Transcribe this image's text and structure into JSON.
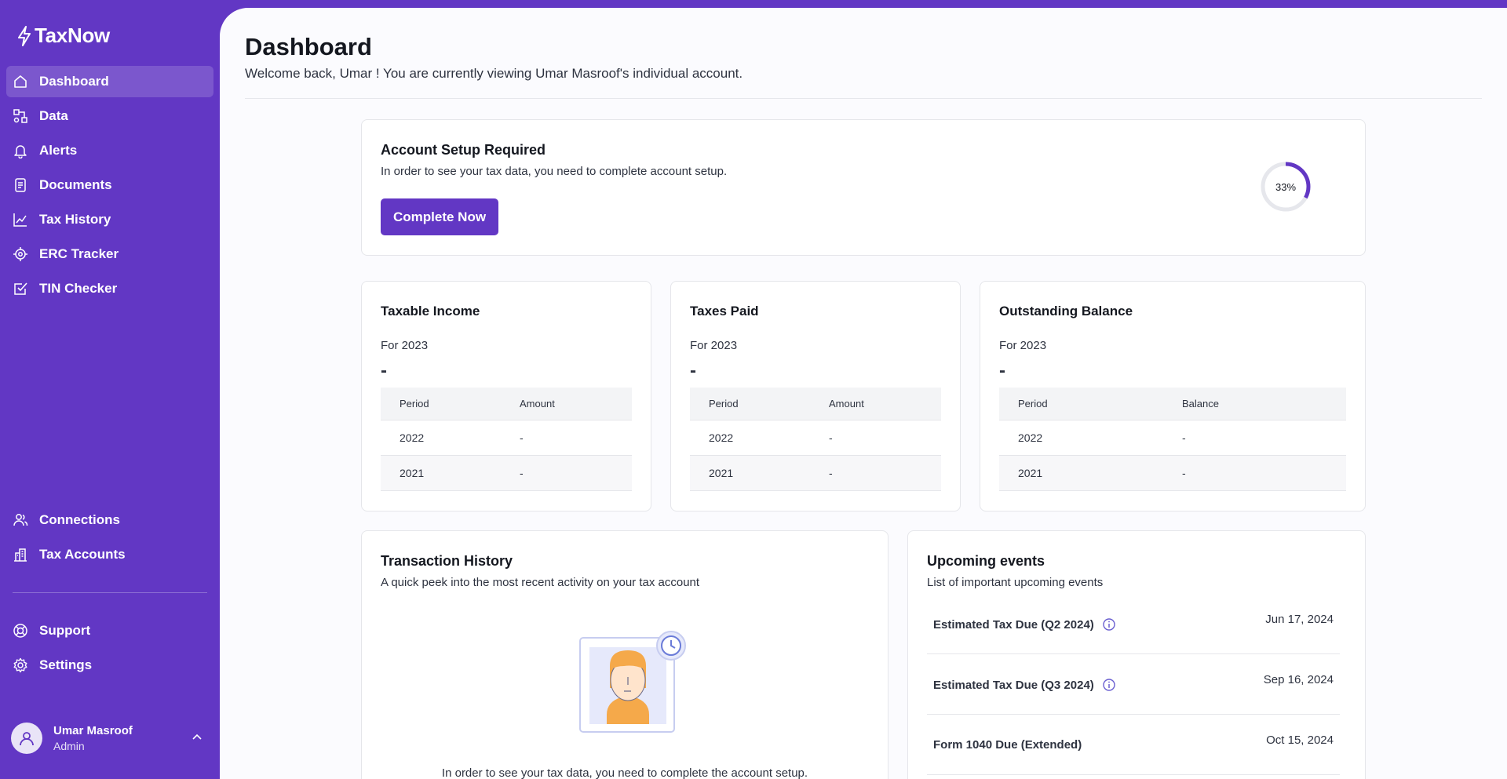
{
  "app": {
    "name": "TaxNow"
  },
  "sidebar": {
    "primary": [
      {
        "label": "Dashboard",
        "icon": "home-icon"
      },
      {
        "label": "Data",
        "icon": "data-icon"
      },
      {
        "label": "Alerts",
        "icon": "bell-icon"
      },
      {
        "label": "Documents",
        "icon": "document-icon"
      },
      {
        "label": "Tax History",
        "icon": "chart-icon"
      },
      {
        "label": "ERC Tracker",
        "icon": "target-icon"
      },
      {
        "label": "TIN Checker",
        "icon": "checkbox-icon"
      }
    ],
    "secondary": [
      {
        "label": "Connections",
        "icon": "users-icon"
      },
      {
        "label": "Tax Accounts",
        "icon": "building-icon"
      }
    ],
    "tertiary": [
      {
        "label": "Support",
        "icon": "lifebuoy-icon"
      },
      {
        "label": "Settings",
        "icon": "gear-icon"
      }
    ],
    "active": "Dashboard"
  },
  "user": {
    "name": "Umar Masroof",
    "role": "Admin"
  },
  "header": {
    "title": "Dashboard",
    "welcome": "Welcome back, Umar ! You are currently viewing Umar Masroof's individual account."
  },
  "setup": {
    "title": "Account Setup Required",
    "description": "In order to see your tax data, you need to complete account setup.",
    "button_label": "Complete Now",
    "progress_percent": 33,
    "progress_label": "33%"
  },
  "stats": [
    {
      "title": "Taxable Income",
      "year": "For 2023",
      "value": "-",
      "columns": [
        "Period",
        "Amount"
      ],
      "rows": [
        [
          "2022",
          "-"
        ],
        [
          "2021",
          "-"
        ]
      ]
    },
    {
      "title": "Taxes Paid",
      "year": "For 2023",
      "value": "-",
      "columns": [
        "Period",
        "Amount"
      ],
      "rows": [
        [
          "2022",
          "-"
        ],
        [
          "2021",
          "-"
        ]
      ]
    },
    {
      "title": "Outstanding Balance",
      "year": "For 2023",
      "value": "-",
      "columns": [
        "Period",
        "Balance"
      ],
      "rows": [
        [
          "2022",
          "-"
        ],
        [
          "2021",
          "-"
        ]
      ]
    }
  ],
  "transactions": {
    "title": "Transaction History",
    "description": "A quick peek into the most recent activity on your tax account",
    "empty_text": "In order to see your tax data, you need to complete the account setup."
  },
  "events": {
    "title": "Upcoming events",
    "description": "List of important upcoming events",
    "items": [
      {
        "title": "Estimated Tax Due (Q2 2024)",
        "date": "Jun 17, 2024",
        "info": true
      },
      {
        "title": "Estimated Tax Due (Q3 2024)",
        "date": "Sep 16, 2024",
        "info": true
      },
      {
        "title": "Form 1040 Due (Extended)",
        "date": "Oct 15, 2024",
        "info": false
      }
    ]
  },
  "colors": {
    "brand": "#6237c4",
    "background": "#fbfbfe",
    "progress_track": "#e6e7ec"
  }
}
